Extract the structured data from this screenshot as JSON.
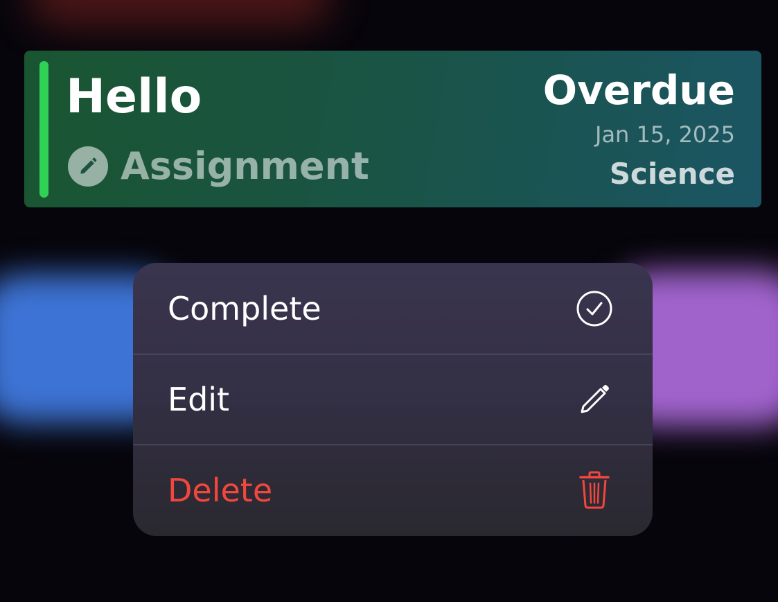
{
  "card": {
    "title": "Hello",
    "type_label": "Assignment",
    "type_icon": "pencil-icon",
    "status": "Overdue",
    "due_date": "Jan 15, 2025",
    "subject": "Science",
    "accent_color": "#2fd157"
  },
  "menu": {
    "items": [
      {
        "label": "Complete",
        "icon": "checkmark-circle-icon"
      },
      {
        "label": "Edit",
        "icon": "pencil-icon"
      },
      {
        "label": "Delete",
        "icon": "trash-icon",
        "color": "#f2473d"
      }
    ]
  }
}
